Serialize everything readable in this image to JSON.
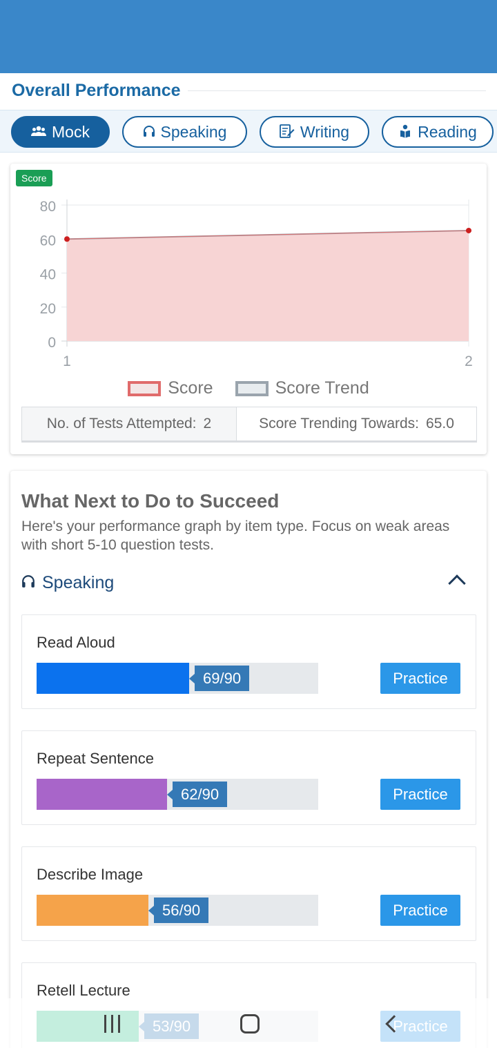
{
  "section_title": "Overall Performance",
  "tabs": [
    {
      "label": "Mock",
      "icon": "users-icon",
      "active": true
    },
    {
      "label": "Speaking",
      "icon": "headphones-icon",
      "active": false
    },
    {
      "label": "Writing",
      "icon": "edit-document-icon",
      "active": false
    },
    {
      "label": "Reading",
      "icon": "reader-icon",
      "active": false
    }
  ],
  "chart": {
    "badge": "Score",
    "legend": [
      "Score",
      "Score Trend"
    ],
    "stats": {
      "attempted_label": "No. of Tests Attempted:",
      "attempted_value": "2",
      "trend_label": "Score Trending Towards:",
      "trend_value": "65.0"
    }
  },
  "chart_data": {
    "type": "area",
    "x": [
      1,
      2
    ],
    "categories": [
      "1",
      "2"
    ],
    "series": [
      {
        "name": "Score",
        "values": [
          60,
          65
        ],
        "color": "#f7d4d4",
        "line": "#e06b6b"
      },
      {
        "name": "Score Trend",
        "values": [
          60,
          65
        ],
        "color": "#e8ecef",
        "line": "#9aa4ad"
      }
    ],
    "yticks": [
      0,
      20,
      40,
      60,
      80
    ],
    "ylim": [
      0,
      80
    ],
    "xlabel": "",
    "ylabel": "",
    "title": "",
    "grid": true,
    "legend_position": "bottom"
  },
  "next": {
    "title": "What Next to Do to Succeed",
    "description": "Here's your performance graph by item type. Focus on weak areas with short 5-10 question tests.",
    "section": "Speaking",
    "items": [
      {
        "label": "Read Aloud",
        "value_text": "69/90",
        "score": 69,
        "max": 90,
        "color": "#0b72ee",
        "practice": "Practice"
      },
      {
        "label": "Repeat Sentence",
        "value_text": "62/90",
        "score": 62,
        "max": 90,
        "color": "#a865c9",
        "practice": "Practice"
      },
      {
        "label": "Describe Image",
        "value_text": "56/90",
        "score": 56,
        "max": 90,
        "color": "#f5a34a",
        "practice": "Practice"
      },
      {
        "label": "Retell Lecture",
        "value_text": "53/90",
        "score": 53,
        "max": 90,
        "color": "#2bc08a",
        "practice": "Practice"
      }
    ]
  },
  "colors": {
    "header": "#3a87c9",
    "primary": "#16609e",
    "badge": "#1a9e55",
    "practice": "#2b97e8"
  }
}
